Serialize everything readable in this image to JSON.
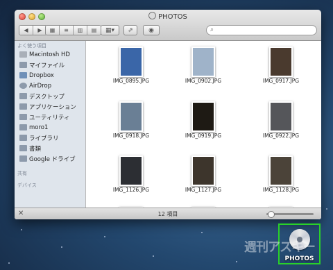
{
  "window": {
    "title": "PHOTOS"
  },
  "toolbar": {
    "back_icon": "chevron-left-icon",
    "forward_icon": "chevron-right-icon",
    "view_modes": [
      "icon-view",
      "list-view",
      "column-view",
      "cover-flow-view"
    ],
    "active_view": "icon-view",
    "search_placeholder": ""
  },
  "sidebar": {
    "section_favorites": "よく使う項目",
    "favorites": [
      {
        "label": "Macintosh HD",
        "icon": "hard-drive-icon"
      },
      {
        "label": "マイファイル",
        "icon": "all-my-files-icon"
      },
      {
        "label": "Dropbox",
        "icon": "dropbox-icon"
      },
      {
        "label": "AirDrop",
        "icon": "airdrop-icon"
      },
      {
        "label": "デスクトップ",
        "icon": "desktop-icon"
      },
      {
        "label": "アプリケーション",
        "icon": "applications-icon"
      },
      {
        "label": "ユーティリティ",
        "icon": "utilities-icon"
      },
      {
        "label": "moro1",
        "icon": "home-icon"
      },
      {
        "label": "ライブラリ",
        "icon": "folder-icon"
      },
      {
        "label": "書類",
        "icon": "documents-icon"
      },
      {
        "label": "Google ドライブ",
        "icon": "folder-icon"
      }
    ],
    "section_shared": "共有",
    "section_devices": "デバイス"
  },
  "files": [
    {
      "name": "IMG_0895.JPG",
      "color": "#3a66a8"
    },
    {
      "name": "IMG_0902.JPG",
      "color": "#9fb3c9"
    },
    {
      "name": "IMG_0917.JPG",
      "color": "#4a3a2e"
    },
    {
      "name": "IMG_0918.JPG",
      "color": "#6a7f95"
    },
    {
      "name": "IMG_0919.JPG",
      "color": "#1e1a14"
    },
    {
      "name": "IMG_0922.JPG",
      "color": "#55565a"
    },
    {
      "name": "IMG_1126.JPG",
      "color": "#2c2e33"
    },
    {
      "name": "IMG_1127.JPG",
      "color": "#3d352c"
    },
    {
      "name": "IMG_1128.JPG",
      "color": "#4b4339"
    },
    {
      "name": "",
      "color": "#5a4e40"
    },
    {
      "name": "",
      "color": "#2b2530"
    },
    {
      "name": "",
      "color": "#6b5a49"
    }
  ],
  "status": {
    "item_count": "12 項目"
  },
  "desktop": {
    "icon_label": "PHOTOS",
    "watermark": "週刊アスキー"
  }
}
